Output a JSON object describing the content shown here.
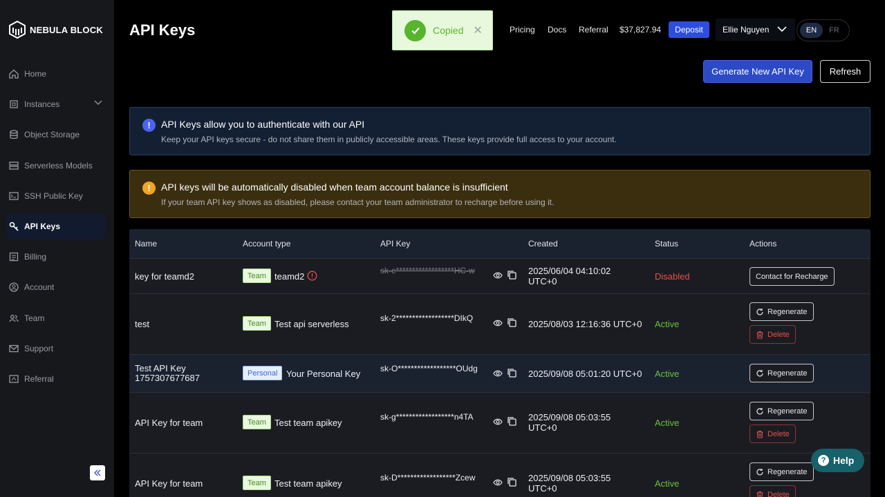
{
  "brand": {
    "name": "NEBULA BLOCK"
  },
  "sidebar": {
    "items": [
      {
        "label": "Home",
        "icon": "home-icon"
      },
      {
        "label": "Instances",
        "icon": "cpu-icon"
      },
      {
        "label": "Object Storage",
        "icon": "database-icon"
      },
      {
        "label": "Serverless Models",
        "icon": "server-icon"
      },
      {
        "label": "SSH Public Key",
        "icon": "terminal-icon"
      },
      {
        "label": "API Keys",
        "icon": "key-icon",
        "active": true
      },
      {
        "label": "Billing",
        "icon": "billing-icon"
      },
      {
        "label": "Account",
        "icon": "user-circle-icon"
      },
      {
        "label": "Team",
        "icon": "team-icon"
      },
      {
        "label": "Support",
        "icon": "mail-icon"
      },
      {
        "label": "Referral",
        "icon": "referral-icon"
      }
    ]
  },
  "page": {
    "title": "API Keys"
  },
  "toast": {
    "text": "Copied"
  },
  "topnav": {
    "pricing": "Pricing",
    "docs": "Docs",
    "referral": "Referral",
    "balance": "$37,827.94",
    "deposit": "Deposit",
    "user": "Ellie Nguyen",
    "lang_en": "EN",
    "lang_fr": "FR"
  },
  "actions": {
    "generate": "Generate New API Key",
    "refresh": "Refresh"
  },
  "alerts": {
    "info": {
      "title": "API Keys allow you to authenticate with our API",
      "body": "Keep your API keys secure - do not share them in publicly accessible areas. These keys provide full access to your account."
    },
    "warn": {
      "title": "API keys will be automatically disabled when team account balance is insufficient",
      "body": "If your team API key shows as disabled, please contact your team administrator to recharge before using it."
    }
  },
  "table": {
    "headers": {
      "name": "Name",
      "account_type": "Account type",
      "api_key": "API Key",
      "created": "Created",
      "status": "Status",
      "actions": "Actions"
    },
    "rows": [
      {
        "name": "key for teamd2",
        "type": "Team",
        "account": "teamd2",
        "key": "sk-e******************HC-w",
        "created": "2025/06/04 04:10:02 UTC+0",
        "status": "Disabled",
        "action1": "Contact for Recharge"
      },
      {
        "name": "test",
        "type": "Team",
        "account": "Test api serverless",
        "key": "sk-2******************DIkQ",
        "created": "2025/08/03 12:16:36 UTC+0",
        "status": "Active",
        "action1": "Regenerate",
        "action2": "Delete"
      },
      {
        "name": "Test API Key 1757307677687",
        "type": "Personal",
        "account": "Your Personal Key",
        "key": "sk-O******************OUdg",
        "created": "2025/09/08 05:01:20 UTC+0",
        "status": "Active",
        "action1": "Regenerate"
      },
      {
        "name": "API Key for team",
        "type": "Team",
        "account": "Test team apikey",
        "key": "sk-g******************n4TA",
        "created": "2025/09/08 05:03:55 UTC+0",
        "status": "Active",
        "action1": "Regenerate",
        "action2": "Delete"
      },
      {
        "name": "API Key for team",
        "type": "Team",
        "account": "Test team apikey",
        "key": "sk-D******************Zcew",
        "created": "2025/09/08 05:03:55 UTC+0",
        "status": "Active",
        "action1": "Regenerate",
        "action2": "Delete"
      }
    ]
  },
  "help": {
    "label": "Help"
  }
}
